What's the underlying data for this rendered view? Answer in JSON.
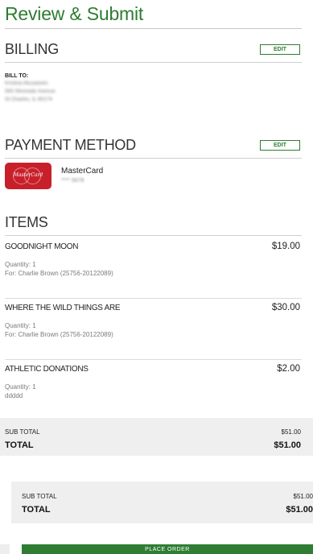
{
  "page": {
    "title": "Review & Submit"
  },
  "billing": {
    "heading": "BILLING",
    "edit_label": "EDIT",
    "bill_to_label": "BILL TO:",
    "address_lines": [
      "Kristina Musawwis",
      "565 Westside Avenue",
      "St Charles, IL 60174"
    ]
  },
  "payment": {
    "heading": "PAYMENT METHOD",
    "edit_label": "EDIT",
    "card_logo_text": "MasterCard",
    "card_name": "MasterCard",
    "card_number": "**** 5678"
  },
  "items": {
    "heading": "ITEMS",
    "list": [
      {
        "name": "GOODNIGHT MOON",
        "price": "$19.00",
        "quantity": "Quantity: 1",
        "for": "For: Charlie Brown (25756-20122089)"
      },
      {
        "name": "WHERE THE WILD THINGS ARE",
        "price": "$30.00",
        "quantity": "Quantity: 1",
        "for": "For: Charlie Brown (25756-20122089)"
      },
      {
        "name": "ATHLETIC DONATIONS",
        "price": "$2.00",
        "quantity": "Quantity: 1",
        "for": "ddddd"
      }
    ]
  },
  "totals": {
    "subtotal_label": "SUB TOTAL",
    "subtotal_value": "$51.00",
    "total_label": "TOTAL",
    "total_value": "$51.00"
  },
  "totals_repeat": {
    "subtotal_label": "SUB TOTAL",
    "subtotal_value": "$51.00",
    "total_label": "TOTAL",
    "total_value": "$51.00"
  },
  "actions": {
    "place_order_label": "PLACE ORDER"
  },
  "colors": {
    "accent": "#2e7d32",
    "card_brand": "#c8202a",
    "totals_bg": "#efefef"
  }
}
